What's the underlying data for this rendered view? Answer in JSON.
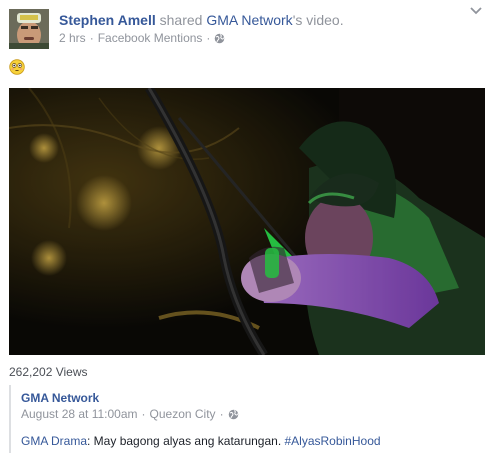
{
  "post": {
    "author": "Stephen Amell",
    "shared_text": "shared",
    "shared_page": "GMA Network",
    "shared_suffix": "'s video.",
    "time": "2 hrs",
    "source": "Facebook Mentions",
    "separator": "·",
    "message_emoji": "😳",
    "privacy_icon": "globe-icon",
    "menu_icon": "chevron-down-icon"
  },
  "video": {
    "views": "262,202 Views"
  },
  "original": {
    "page": "GMA Network",
    "date": "August 28 at 11:00am",
    "location": "Quezon City",
    "separator": "·",
    "text_link": "GMA Drama",
    "text_body": ": May bagong alyas ang katarungan. ",
    "hashtag": "#AlyasRobinHood"
  },
  "colors": {
    "link": "#365899",
    "meta": "#90949c",
    "text": "#1d2129",
    "arrow_fletching": "#2bd84a",
    "jacket": "#2e7a37"
  }
}
